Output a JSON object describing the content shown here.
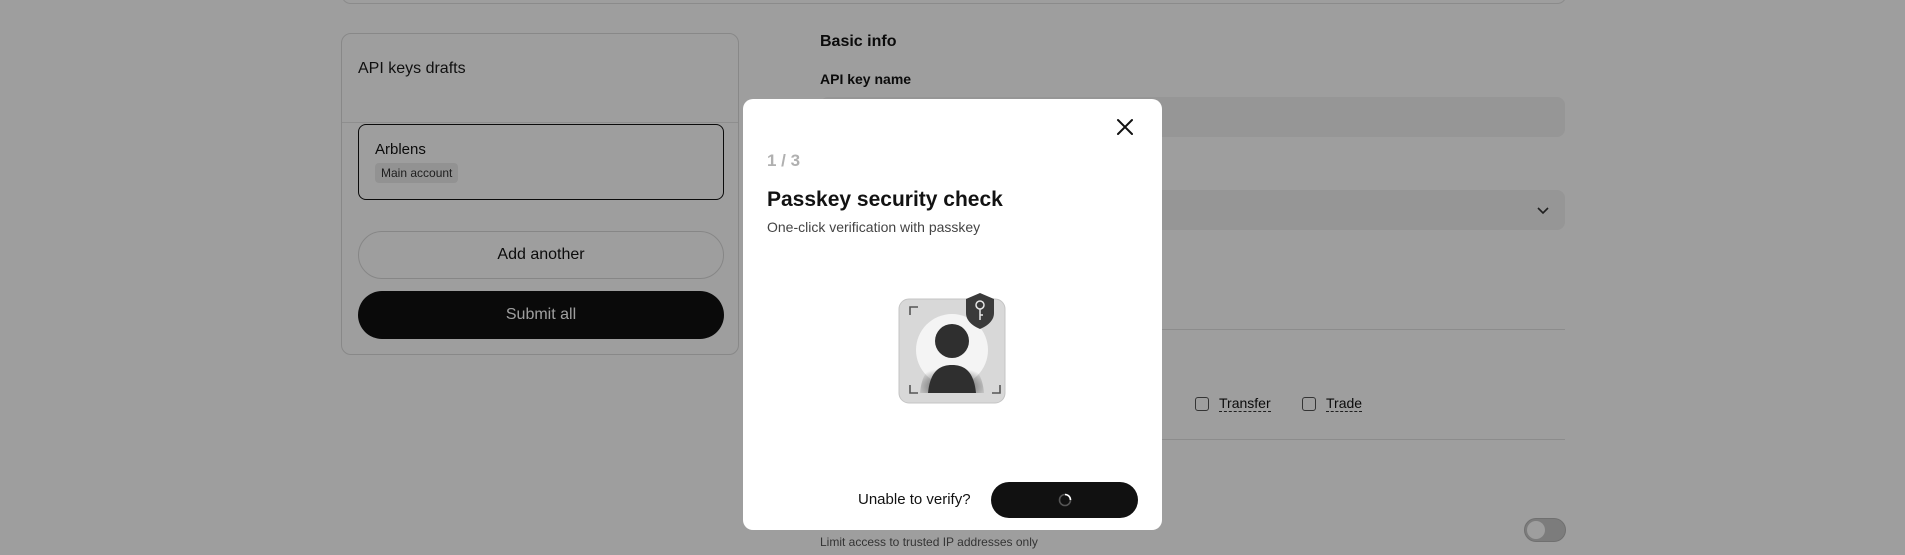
{
  "drafts": {
    "title": "API keys drafts",
    "items": [
      {
        "name": "Arblens",
        "tag": "Main account"
      }
    ],
    "add_label": "Add another",
    "submit_label": "Submit all"
  },
  "form": {
    "section_title": "Basic info",
    "name_label": "API key name",
    "permissions": [
      {
        "label": "Transfer"
      },
      {
        "label": "Trade"
      }
    ],
    "ip_hint": "Limit access to trusted IP addresses only"
  },
  "modal": {
    "step": "1 / 3",
    "title": "Passkey security check",
    "subtitle": "One-click verification with passkey",
    "unable_label": "Unable to verify?",
    "close_icon": "close-icon",
    "spinner_icon": "spinner-icon"
  },
  "colors": {
    "primary": "#111111",
    "overlay": "rgba(0,0,0,0.38)",
    "muted": "#b0b0b0"
  }
}
